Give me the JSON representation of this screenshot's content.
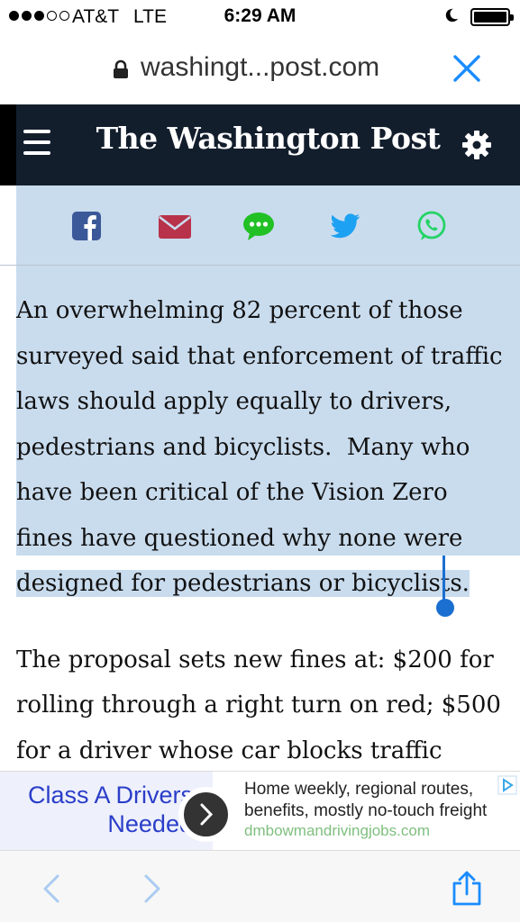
{
  "status_bar": {
    "carrier": "AT&T",
    "network": "LTE",
    "time": "6:29 AM",
    "signal_bars_filled": 3,
    "signal_bars_total": 5
  },
  "url_bar": {
    "url": "washingt...post.com",
    "close_icon": "close-x-icon"
  },
  "header": {
    "masthead": "The Washington Post",
    "menu_icon": "hamburger-menu-icon",
    "settings_icon": "gear-icon"
  },
  "share_bar": {
    "items": [
      {
        "icon": "facebook-icon",
        "color": "#3b5998"
      },
      {
        "icon": "email-icon",
        "color": "#b8324a"
      },
      {
        "icon": "sms-icon",
        "color": "#21c024"
      },
      {
        "icon": "twitter-icon",
        "color": "#1da1f2"
      },
      {
        "icon": "whatsapp-icon",
        "color": "#25d366"
      }
    ]
  },
  "article": {
    "selected_lines": [
      "An overwhelming 82 percent of those",
      "surveyed said that enforcement of traffic",
      "laws should apply equally to drivers,",
      "pedestrians and bicyclists.  Many who",
      "have been critical of the Vision Zero",
      "fines have questioned why none were",
      "designed for pedestrians or bicyclists."
    ],
    "paragraph2_lines": [
      "The proposal sets new fines at: $200 for",
      "rolling through a right turn on red; $500",
      "for a driver whose car blocks traffic while"
    ]
  },
  "ad": {
    "headline_line1": "Class A Drivers",
    "headline_line2": "Needed",
    "body": "Home weekly, regional routes, benefits, mostly no-touch freight",
    "url": "dmbowmandrivingjobs.com"
  },
  "toolbar": {
    "back_icon": "back-chevron-icon",
    "forward_icon": "forward-chevron-icon",
    "share_icon": "share-icon"
  },
  "colors": {
    "selection": "#c9dcee",
    "header_bg": "#131e2d",
    "caret": "#1a6fd1",
    "ios_blue": "#1a8cff"
  }
}
